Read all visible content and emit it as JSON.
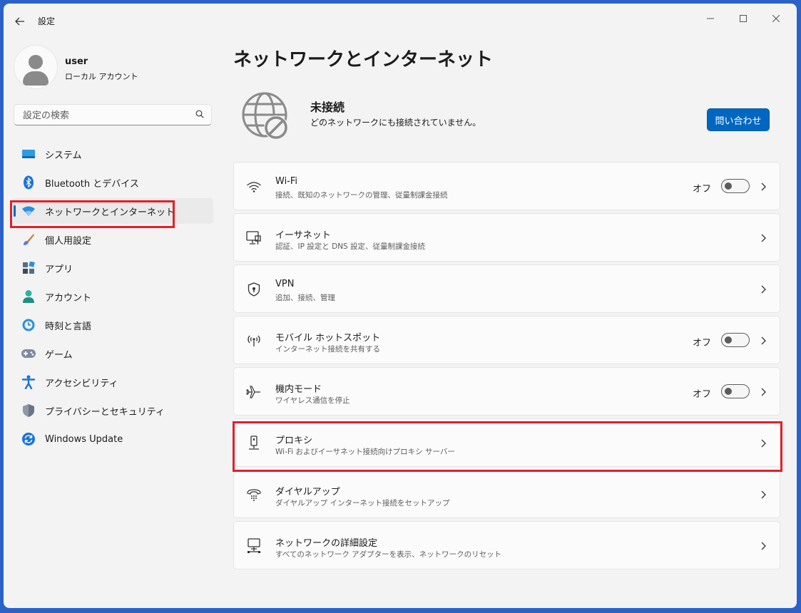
{
  "app": {
    "title": "設定"
  },
  "user": {
    "name": "user",
    "account_type": "ローカル アカウント"
  },
  "search": {
    "placeholder": "設定の検索"
  },
  "sidebar": {
    "items": [
      {
        "label": "システム",
        "icon": "system-icon"
      },
      {
        "label": "Bluetooth とデバイス",
        "icon": "bluetooth-icon"
      },
      {
        "label": "ネットワークとインターネット",
        "icon": "wifi-icon",
        "active": true
      },
      {
        "label": "個人用設定",
        "icon": "brush-icon"
      },
      {
        "label": "アプリ",
        "icon": "apps-icon"
      },
      {
        "label": "アカウント",
        "icon": "account-icon"
      },
      {
        "label": "時刻と言語",
        "icon": "time-language-icon"
      },
      {
        "label": "ゲーム",
        "icon": "gamepad-icon"
      },
      {
        "label": "アクセシビリティ",
        "icon": "accessibility-icon"
      },
      {
        "label": "プライバシーとセキュリティ",
        "icon": "shield-icon"
      },
      {
        "label": "Windows Update",
        "icon": "windows-update-icon"
      }
    ]
  },
  "main": {
    "title": "ネットワークとインターネット",
    "status": {
      "title": "未接続",
      "description": "どのネットワークにも接続されていません。",
      "button_label": "問い合わせ"
    },
    "cards": [
      {
        "title": "Wi-Fi",
        "subtitle": "接続、既知のネットワークの管理、従量制課金接続",
        "icon": "wifi-icon",
        "toggle_label": "オフ",
        "toggle_on": false
      },
      {
        "title": "イーサネット",
        "subtitle": "認証、IP 設定と DNS 設定、従量制課金接続",
        "icon": "ethernet-icon"
      },
      {
        "title": "VPN",
        "subtitle": "追加、接続、管理",
        "icon": "vpn-shield-icon"
      },
      {
        "title": "モバイル ホットスポット",
        "subtitle": "インターネット接続を共有する",
        "icon": "hotspot-icon",
        "toggle_label": "オフ",
        "toggle_on": false
      },
      {
        "title": "機内モード",
        "subtitle": "ワイヤレス通信を停止",
        "icon": "airplane-icon",
        "toggle_label": "オフ",
        "toggle_on": false
      },
      {
        "title": "プロキシ",
        "subtitle": "Wi-Fi およびイーサネット接続向けプロキシ サーバー",
        "icon": "proxy-icon"
      },
      {
        "title": "ダイヤルアップ",
        "subtitle": "ダイヤルアップ インターネット接続をセットアップ",
        "icon": "dialup-icon"
      },
      {
        "title": "ネットワークの詳細設定",
        "subtitle": "すべてのネットワーク アダプターを表示、ネットワークのリセット",
        "icon": "advanced-network-icon"
      }
    ]
  },
  "colors": {
    "accent": "#0067c0",
    "highlight": "#e3202a",
    "desktop": "#2a62c8"
  }
}
